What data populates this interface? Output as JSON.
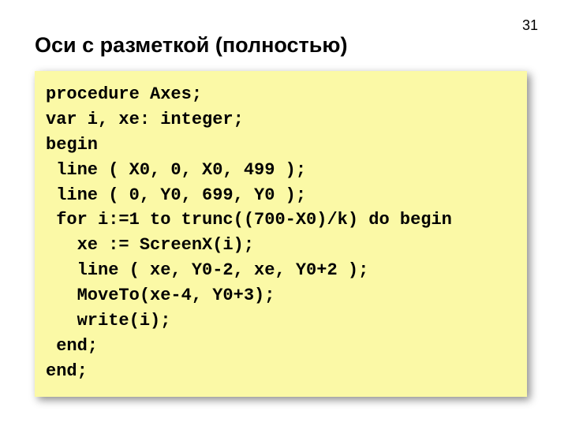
{
  "page_number": "31",
  "title": "Оси с разметкой (полностью)",
  "code": {
    "l0": "procedure Axes;",
    "l1": "var i, xe: integer;",
    "l2": "begin",
    "l3": " line ( X0, 0, X0, 499 );",
    "l4": " line ( 0, Y0, 699, Y0 );",
    "l5": " for i:=1 to trunc((700-X0)/k) do begin",
    "l6": "   xe := ScreenX(i);",
    "l7": "   line ( xe, Y0-2, xe, Y0+2 );",
    "l8": "   MoveTo(xe-4, Y0+3);",
    "l9": "   write(i);",
    "l10": " end;",
    "l11": "end;"
  }
}
